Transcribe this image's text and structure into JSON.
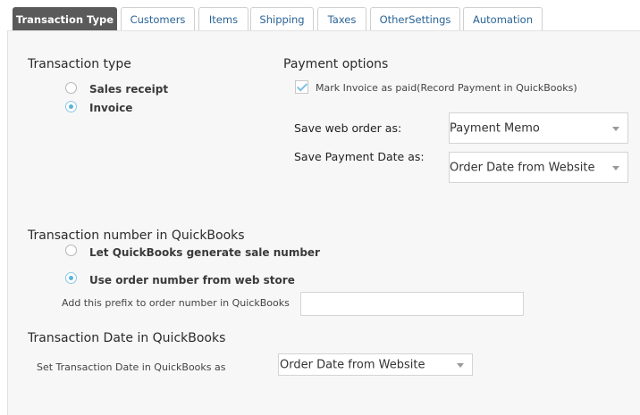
{
  "tabs": [
    {
      "label": "Transaction Type",
      "active": true
    },
    {
      "label": "Customers"
    },
    {
      "label": "Items"
    },
    {
      "label": "Shipping"
    },
    {
      "label": "Taxes"
    },
    {
      "label": "OtherSettings"
    },
    {
      "label": "Automation"
    }
  ],
  "transaction_type": {
    "title": "Transaction type",
    "options": [
      {
        "label": "Sales receipt",
        "selected": false
      },
      {
        "label": "Invoice",
        "selected": true
      }
    ]
  },
  "payment_options": {
    "title": "Payment options",
    "mark_paid_label": "Mark Invoice as paid(Record Payment in QuickBooks)",
    "mark_paid_checked": true,
    "save_web_order_label": "Save web order as:",
    "save_web_order_value": "Payment Memo",
    "save_payment_date_label": "Save Payment Date as:",
    "save_payment_date_value": "Order Date from Website"
  },
  "transaction_number": {
    "title": "Transaction number in QuickBooks",
    "options": [
      {
        "label": "Let QuickBooks generate sale number",
        "selected": false
      },
      {
        "label": "Use order number from web store",
        "selected": true
      }
    ],
    "prefix_label": "Add this prefix to order number in QuickBooks",
    "prefix_value": ""
  },
  "transaction_date": {
    "title": "Transaction Date in QuickBooks",
    "set_label": "Set Transaction Date in QuickBooks as",
    "set_value": "Order Date from Website"
  },
  "colors": {
    "active_tab": "#5a5a5a",
    "tab_text": "#2a6496",
    "radio_selected": "#5bb2de",
    "panel_bg": "#f7f7f7"
  }
}
